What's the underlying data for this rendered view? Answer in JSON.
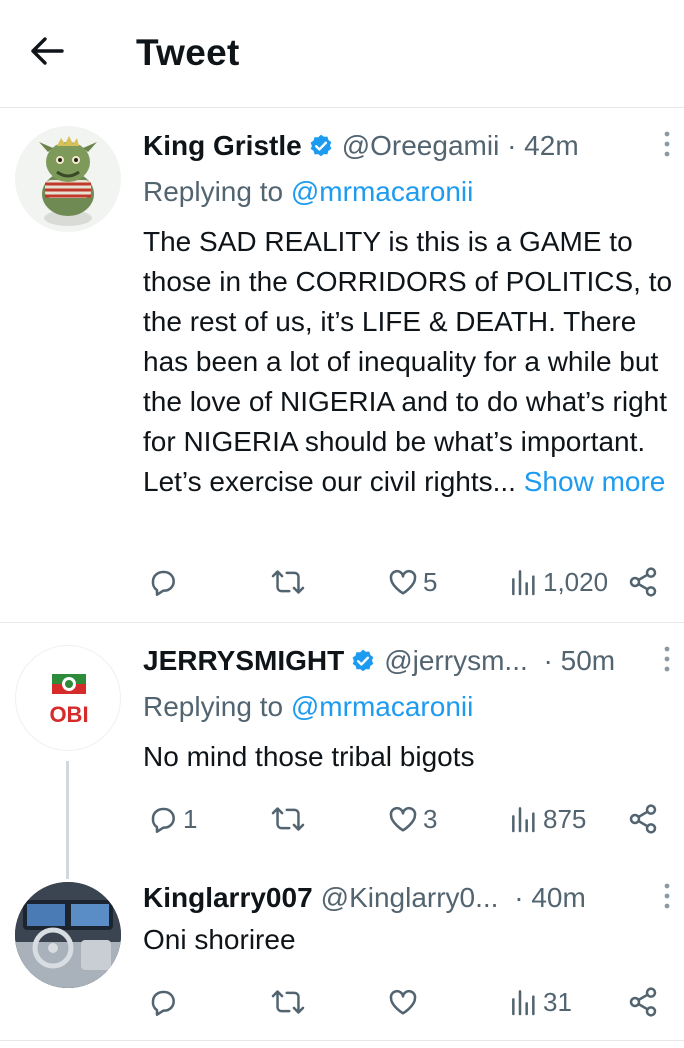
{
  "header": {
    "title": "Tweet",
    "back_icon": "arrow-left-icon"
  },
  "colors": {
    "link": "#1d9bf0",
    "verified": "#1d9bf0",
    "secondary_text": "#536471",
    "text": "#0f1419"
  },
  "tweets": [
    {
      "name": "King Gristle",
      "verified": true,
      "handle": "@Oreegamii",
      "time": " · 42m",
      "reply_prefix": "Replying to ",
      "reply_to": "@mrmacaronii",
      "text": "The SAD REALITY is this is a GAME to those in the CORRIDORS of POLITICS, to the rest of us, it’s LIFE & DEATH. There has been a lot of inequality for a while  but the love of NIGERIA and to do what’s right for NIGERIA should be what’s important. Let’s exercise our civil rights...",
      "show_more": "Show more",
      "replies": "",
      "retweets": "",
      "likes": "5",
      "views": "1,020"
    },
    {
      "name": "JERRYSMIGHT",
      "verified": true,
      "handle": "@jerrysm...",
      "time": " · 50m",
      "reply_prefix": "Replying to ",
      "reply_to": "@mrmacaronii",
      "text": "No mind those tribal bigots",
      "avatar_label": "OBI",
      "replies": "1",
      "retweets": "",
      "likes": "3",
      "views": "875"
    },
    {
      "name": "Kinglarry007",
      "verified": false,
      "handle": "@Kinglarry0...",
      "time": " · 40m",
      "text": "Oni shoriree",
      "replies": "",
      "retweets": "",
      "likes": "",
      "views": "31"
    }
  ]
}
